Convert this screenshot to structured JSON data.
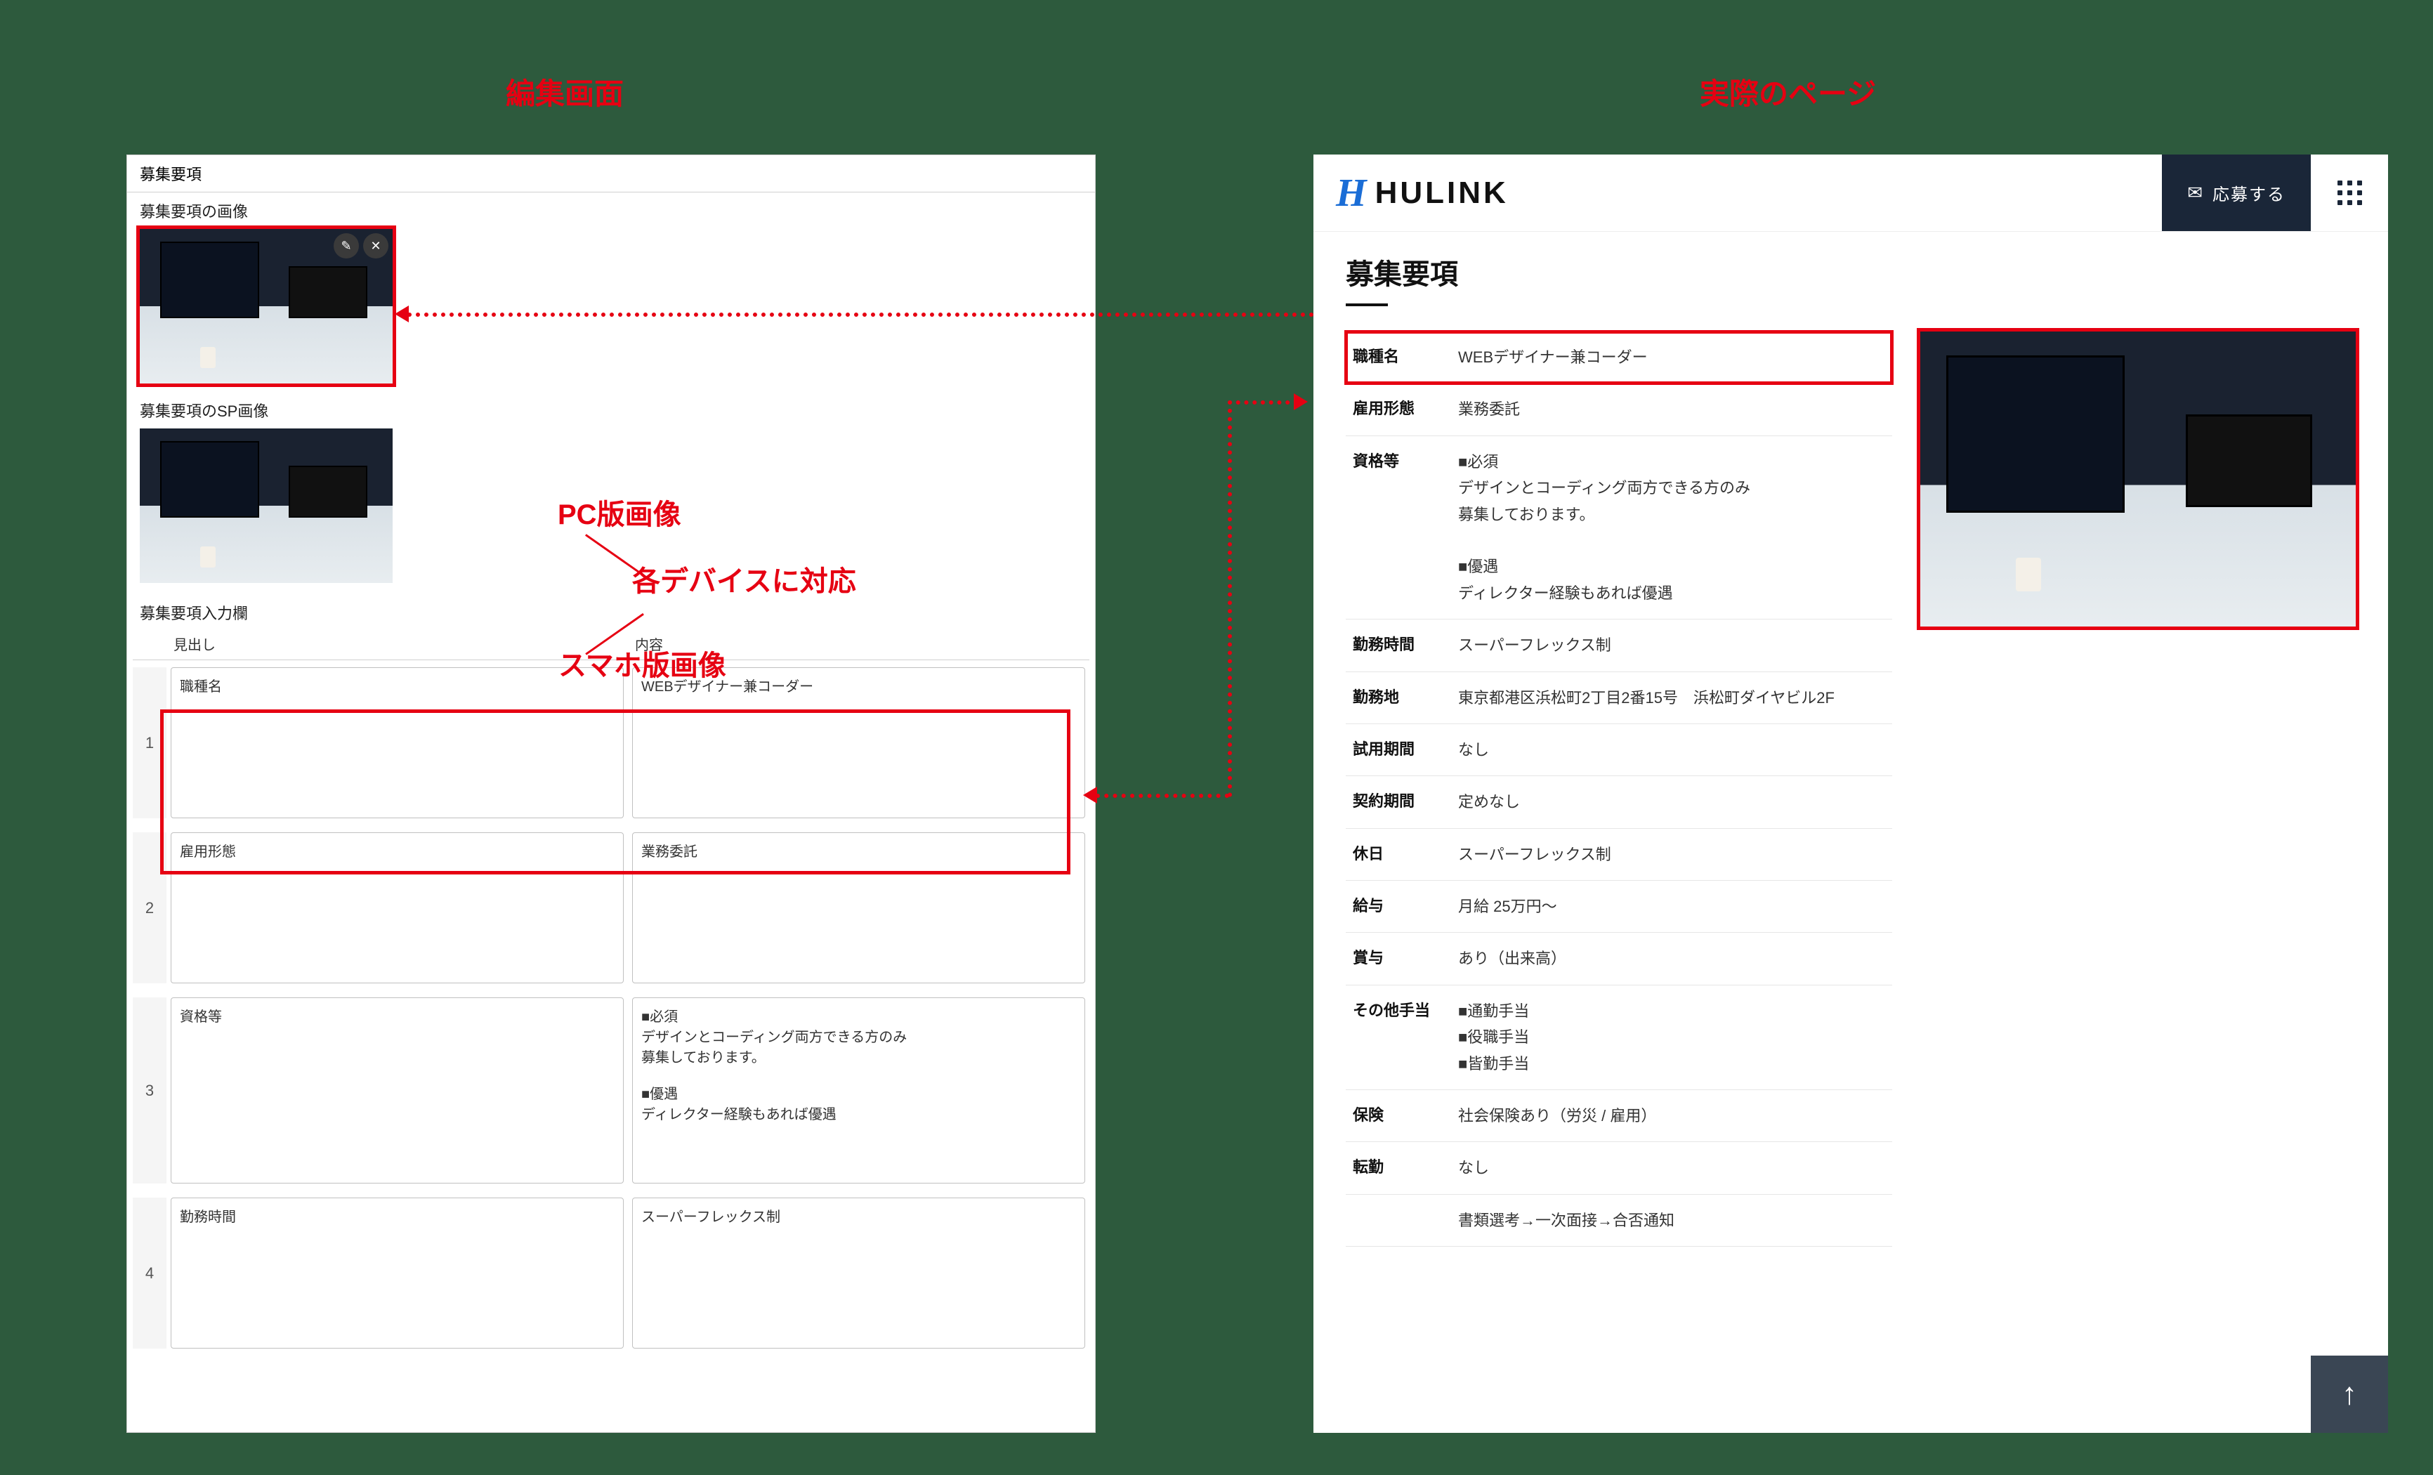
{
  "titles": {
    "editor": "編集画面",
    "preview": "実際のページ"
  },
  "annotations": {
    "pc_image": "PC版画像",
    "sp_image": "スマホ版画像",
    "device_support": "各デバイスに対応"
  },
  "editor": {
    "panel_title": "募集要項",
    "pc_image_label": "募集要項の画像",
    "sp_image_label": "募集要項のSP画像",
    "table_label": "募集要項入力欄",
    "columns": {
      "heading": "見出し",
      "content": "内容"
    },
    "rows": [
      {
        "idx": "1",
        "heading": "職種名",
        "content": "WEBデザイナー兼コーダー"
      },
      {
        "idx": "2",
        "heading": "雇用形態",
        "content": "業務委託"
      },
      {
        "idx": "3",
        "heading": "資格等",
        "content": "■必須\nデザインとコーディング両方できる方のみ\n募集しております。\n\n■優遇\nディレクター経験もあれば優遇"
      },
      {
        "idx": "4",
        "heading": "勤務時間",
        "content": "スーパーフレックス制"
      }
    ]
  },
  "preview": {
    "brand": "HULINK",
    "apply_label": "応募する",
    "section_title": "募集要項",
    "details": [
      {
        "k": "職種名",
        "v": "WEBデザイナー兼コーダー"
      },
      {
        "k": "雇用形態",
        "v": "業務委託"
      },
      {
        "k": "資格等",
        "v": "■必須\nデザインとコーディング両方できる方のみ\n募集しております。\n\n■優遇\nディレクター経験もあれば優遇"
      },
      {
        "k": "勤務時間",
        "v": "スーパーフレックス制"
      },
      {
        "k": "勤務地",
        "v": "東京都港区浜松町2丁目2番15号　浜松町ダイヤビル2F"
      },
      {
        "k": "試用期間",
        "v": "なし"
      },
      {
        "k": "契約期間",
        "v": "定めなし"
      },
      {
        "k": "休日",
        "v": "スーパーフレックス制"
      },
      {
        "k": "給与",
        "v": "月給 25万円〜"
      },
      {
        "k": "賞与",
        "v": "あり（出来高）"
      },
      {
        "k": "その他手当",
        "v": "■通勤手当\n■役職手当\n■皆勤手当"
      },
      {
        "k": "保険",
        "v": "社会保険あり（労災 / 雇用）"
      },
      {
        "k": "転勤",
        "v": "なし"
      },
      {
        "k": "",
        "v": "書類選考→一次面接→合否通知"
      }
    ],
    "scroll_top_glyph": "↑"
  }
}
